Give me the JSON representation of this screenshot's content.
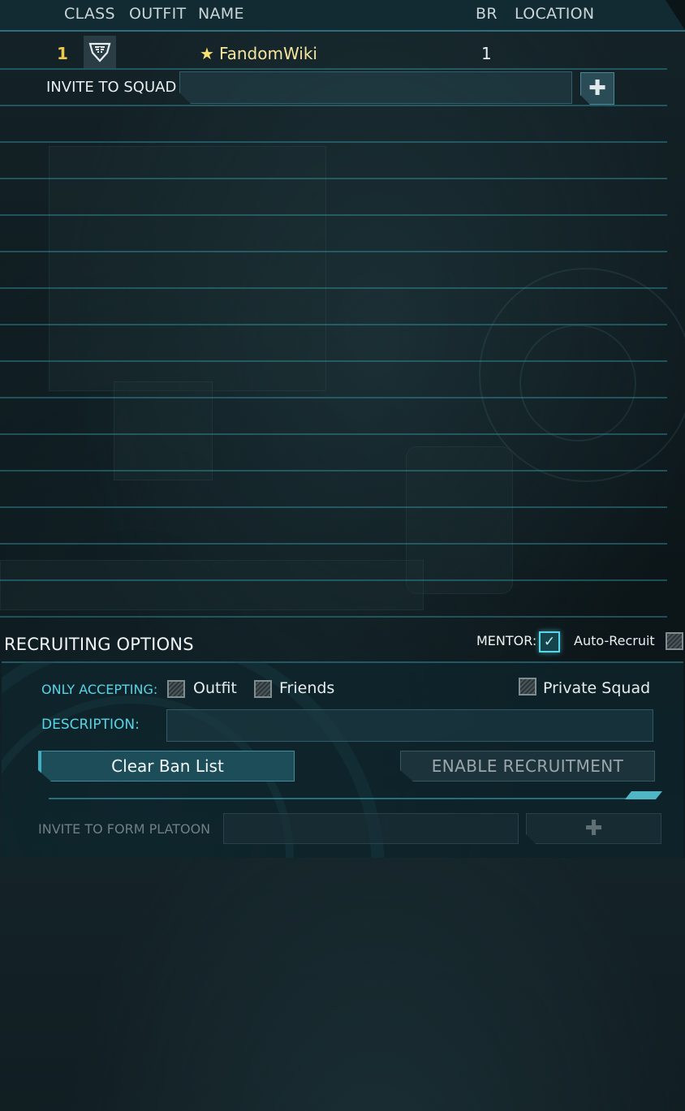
{
  "header": {
    "columns": {
      "class": "CLASS",
      "outfit": "OUTFIT",
      "name": "NAME",
      "br": "BR",
      "location": "LOCATION"
    }
  },
  "members": [
    {
      "slot": "1",
      "class_icon": "infiltrator-class-icon",
      "name": "FandomWiki",
      "leader_icon": "star-icon",
      "leader_symbol": "★",
      "br": "1",
      "location": ""
    }
  ],
  "invite_squad": {
    "label": "INVITE TO SQUAD",
    "value": "",
    "add_symbol": "✚"
  },
  "recruiting": {
    "title": "RECRUITING OPTIONS",
    "mentor_label": "MENTOR:",
    "mentor_checked": true,
    "mentor_check_symbol": "✓",
    "auto_recruit_label": "Auto-Recruit",
    "auto_recruit_checked": false,
    "only_accepting_label": "ONLY ACCEPTING:",
    "outfit_label": "Outfit",
    "outfit_checked": false,
    "friends_label": "Friends",
    "friends_checked": false,
    "private_squad_label": "Private Squad",
    "private_squad_checked": false,
    "description_label": "DESCRIPTION:",
    "description_value": "",
    "clear_ban_list_label": "Clear Ban List",
    "enable_recruitment_label": "ENABLE RECRUITMENT"
  },
  "invite_platoon": {
    "label": "INVITE TO FORM PLATOON",
    "value": "",
    "add_symbol": "✚"
  },
  "colors": {
    "accent": "#58d4e6",
    "leader_gold": "#f1c748",
    "header_bg": "#122a31"
  }
}
